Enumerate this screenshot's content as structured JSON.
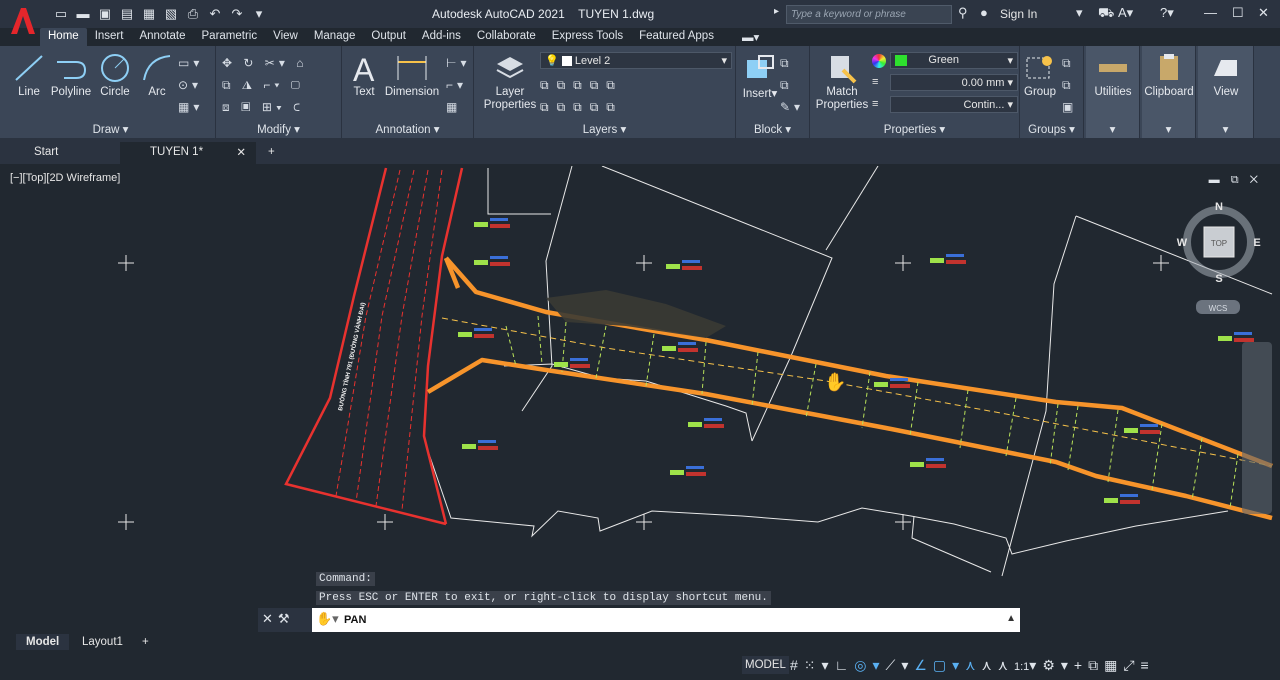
{
  "app": {
    "title": "Autodesk AutoCAD 2021",
    "filename": "TUYEN 1.dwg",
    "search_placeholder": "Type a keyword or phrase",
    "sign_in": "Sign In"
  },
  "ribbon_tabs": [
    "Home",
    "Insert",
    "Annotate",
    "Parametric",
    "View",
    "Manage",
    "Output",
    "Add-ins",
    "Collaborate",
    "Express Tools",
    "Featured Apps"
  ],
  "ribbon": {
    "draw": {
      "title": "Draw",
      "line": "Line",
      "polyline": "Polyline",
      "circle": "Circle",
      "arc": "Arc"
    },
    "modify": {
      "title": "Modify"
    },
    "annotation": {
      "title": "Annotation",
      "text": "Text",
      "dimension": "Dimension"
    },
    "layers": {
      "title": "Layers",
      "layer_properties": "Layer Properties",
      "current_layer": "Level 2"
    },
    "block": {
      "title": "Block",
      "insert": "Insert"
    },
    "properties": {
      "title": "Properties",
      "match": "Match Properties",
      "color": "Green",
      "lineweight": "0.00 mm",
      "linetype": "Contin..."
    },
    "groups": {
      "title": "Groups",
      "group": "Group"
    },
    "utilities": "Utilities",
    "clipboard": "Clipboard",
    "view": "View"
  },
  "doc_tabs": {
    "start": "Start",
    "current": "TUYEN 1*"
  },
  "viewport": {
    "label": "[−][Top][2D Wireframe]",
    "viewcube": {
      "n": "N",
      "s": "S",
      "e": "E",
      "w": "W",
      "top": "TOP",
      "wcs": "WCS"
    },
    "road_label": "ĐƯỜNG TỈNH 791 (ĐƯỜNG VÀNH ĐAI)"
  },
  "command": {
    "history_1": "Command:",
    "history_2": "Press ESC or ENTER to exit, or right-click to display shortcut menu.",
    "current": "PAN"
  },
  "layout_tabs": [
    "Model",
    "Layout1"
  ],
  "status": {
    "model": "MODEL",
    "scale": "1:1"
  },
  "colors": {
    "accent_orange": "#f7942b",
    "green_line": "#b9e25a",
    "red_line": "#e8322f"
  }
}
